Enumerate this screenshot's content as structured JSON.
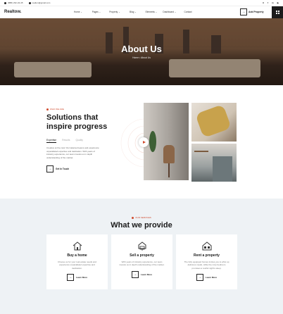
{
  "topbar": {
    "phone": "(888) 232-34-45",
    "email": "realton@gmail.com",
    "socials": [
      "X",
      "f",
      "in",
      "▶"
    ]
  },
  "nav": {
    "logo": "Realtow.",
    "menu": [
      "Home ⌄",
      "Pages ⌄",
      "Property ⌄",
      "Blog ⌄",
      "Elements ⌄",
      "Dashboard ⌄",
      "Contact"
    ],
    "add_property": "Add Property",
    "add_property_arrow": "→"
  },
  "hero": {
    "title": "About Us",
    "breadcrumb": "Home • About Us"
  },
  "about": {
    "tag": "WHO WE ARE",
    "heading_line1": "Solutions that",
    "heading_line2": "inspire progress",
    "tabs": [
      "Expertise",
      "Results",
      "Quality"
    ],
    "paragraph": "Creative at the core! Our talented teams and experience unparalleled expertise and dedication. With years of industry experience, our team invests us in depth understanding of the market.",
    "cta": "Get In Touch",
    "cta_arrow": "→"
  },
  "services": {
    "tag": "OUR SERVICES",
    "heading": "What we provide",
    "cards": [
      {
        "title": "Buy a home",
        "text": "Choose us for your real estate needs and experience unparalleled expertise and dedication.",
        "link": "Learn More",
        "arrow": "→"
      },
      {
        "title": "Sell a property",
        "text": "With years of industry experience, our team invests us in depth understanding of the market.",
        "link": "Learn More",
        "arrow": "→"
      },
      {
        "title": "Rent a property",
        "text": "The fully equipped homes invites you to whip up delicious meals, while the cozy bedroom promises a restful night's sleep.",
        "link": "Learn More",
        "arrow": "→"
      }
    ]
  },
  "colors": {
    "accent": "#d04a2e",
    "dark": "#1b1b1b",
    "services_bg": "#eef2f5"
  }
}
